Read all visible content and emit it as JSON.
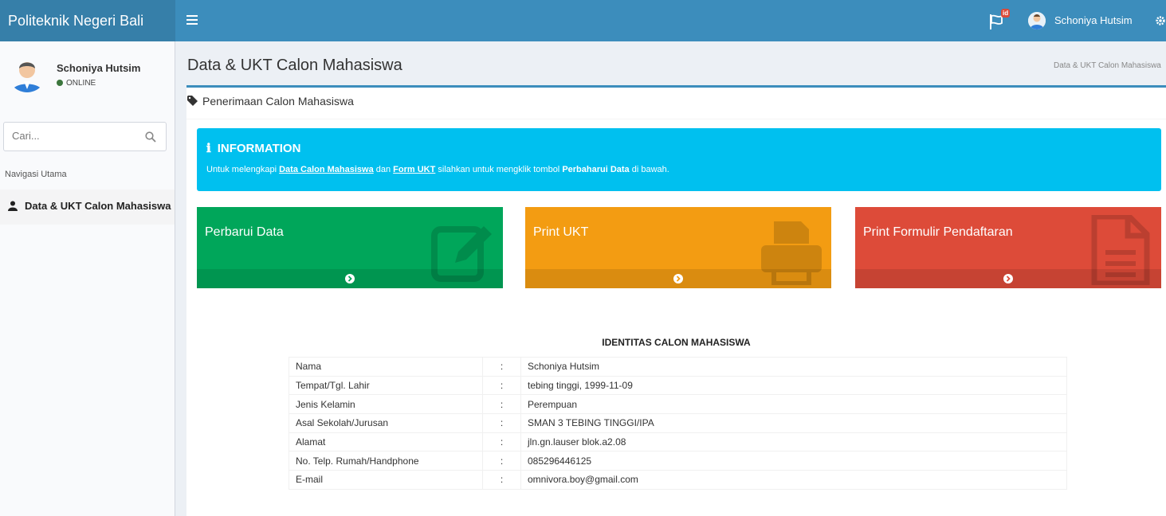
{
  "header": {
    "brand": "Politeknik Negeri Bali",
    "notification_badge": "id",
    "user_name": "Schoniya Hutsim"
  },
  "sidebar": {
    "user_name": "Schoniya Hutsim",
    "status": "ONLINE",
    "search_placeholder": "Cari...",
    "nav_header": "Navigasi Utama",
    "items": [
      {
        "label": "Data & UKT Calon Mahasiswa",
        "icon": "user-icon"
      }
    ]
  },
  "content": {
    "title": "Data & UKT Calon Mahasiswa",
    "breadcrumb": "Data & UKT Calon Mahasiswa",
    "box_title": "Penerimaan Calon Mahasiswa",
    "callout": {
      "title": "INFORMATION",
      "text_1": "Untuk melengkapi ",
      "link_1": "Data Calon Mahasiswa",
      "text_2": " dan ",
      "link_2": "Form UKT",
      "text_3": " silahkan untuk mengklik tombol ",
      "bold_1": "Perbaharui Data",
      "text_4": " di bawah."
    },
    "tiles": [
      {
        "label": "Perbarui Data",
        "color": "#00a65a",
        "icon": "edit-icon"
      },
      {
        "label": "Print UKT",
        "color": "#f39c12",
        "icon": "print-icon"
      },
      {
        "label": "Print Formulir Pendaftaran",
        "color": "#dd4b39",
        "icon": "file-icon"
      }
    ],
    "identity": {
      "title": "IDENTITAS CALON MAHASISWA",
      "separator": ":",
      "rows": [
        {
          "label": "Nama",
          "value": "Schoniya Hutsim"
        },
        {
          "label": "Tempat/Tgl. Lahir",
          "value": "tebing tinggi, 1999-11-09"
        },
        {
          "label": "Jenis Kelamin",
          "value": "Perempuan"
        },
        {
          "label": "Asal Sekolah/Jurusan",
          "value": "SMAN 3 TEBING TINGGI/IPA"
        },
        {
          "label": "Alamat",
          "value": "jln.gn.lauser blok.a2.08"
        },
        {
          "label": "No. Telp. Rumah/Handphone",
          "value": "085296446125"
        },
        {
          "label": "E-mail",
          "value": "omnivora.boy@gmail.com"
        }
      ]
    }
  },
  "colors": {
    "topbar": "#3c8dbc",
    "brand_bg": "#367fa9",
    "callout": "#00c0ef"
  }
}
